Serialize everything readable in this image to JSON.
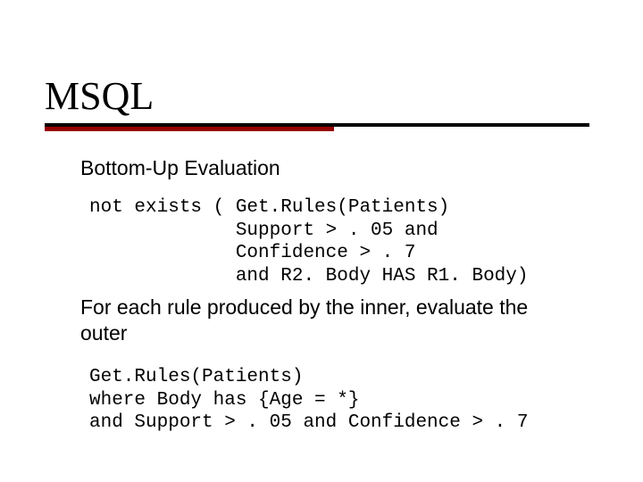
{
  "title": "MSQL",
  "subhead": "Bottom-Up Evaluation",
  "code1": "not exists ( Get.Rules(Patients)\n             Support > . 05 and\n             Confidence > . 7\n             and R2. Body HAS R1. Body)",
  "midtext": "For each rule produced by the inner, evaluate the outer",
  "code2": "Get.Rules(Patients)\nwhere Body has {Age = *}\nand Support > . 05 and Confidence > . 7"
}
